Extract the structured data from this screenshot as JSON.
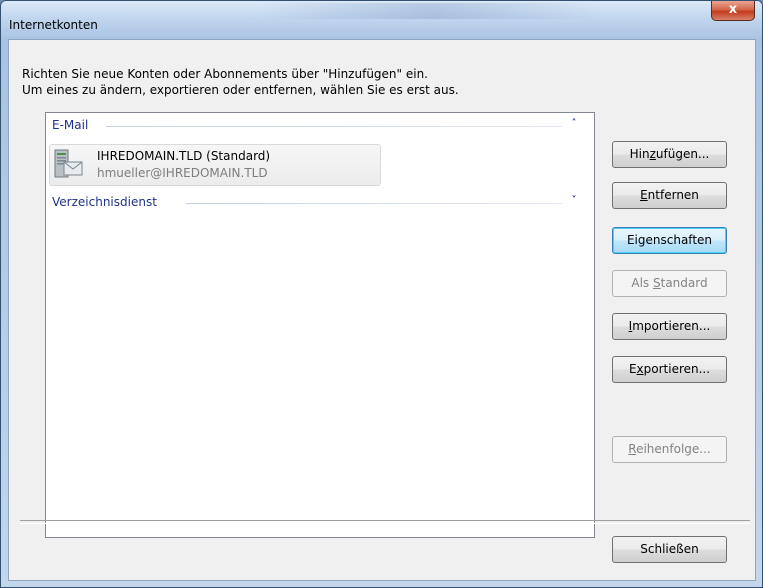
{
  "window": {
    "title": "Internetkonten",
    "close_label": "x"
  },
  "instructions": {
    "line1": "Richten Sie neue Konten oder Abonnements über \"Hinzufügen\" ein.",
    "line2": "Um eines zu ändern, exportieren oder entfernen, wählen Sie es erst aus."
  },
  "groups": {
    "email": {
      "label": "E-Mail",
      "chevron": "˄"
    },
    "directory": {
      "label": "Verzeichnisdienst",
      "chevron": "˅"
    }
  },
  "account": {
    "name": "IHREDOMAIN.TLD (Standard)",
    "email": "hmueller@IHREDOMAIN.TLD",
    "icon": "mail-server-icon"
  },
  "buttons": {
    "add": {
      "pre": "Hin",
      "key": "z",
      "post": "ufügen..."
    },
    "remove": {
      "pre": "",
      "key": "E",
      "post": "ntfernen"
    },
    "properties": {
      "pre": "Eigenschaften",
      "key": "",
      "post": ""
    },
    "default": {
      "pre": "Als ",
      "key": "S",
      "post": "tandard"
    },
    "import": {
      "pre": "",
      "key": "I",
      "post": "mportieren..."
    },
    "export": {
      "pre": "E",
      "key": "x",
      "post": "portieren..."
    },
    "order": {
      "pre": "",
      "key": "R",
      "post": "eihenfolge..."
    },
    "close": {
      "pre": "Schließen",
      "key": "",
      "post": ""
    }
  },
  "colors": {
    "group_header": "#1e3287",
    "focus_border": "#3c7fb1",
    "disabled_text": "#838383"
  }
}
